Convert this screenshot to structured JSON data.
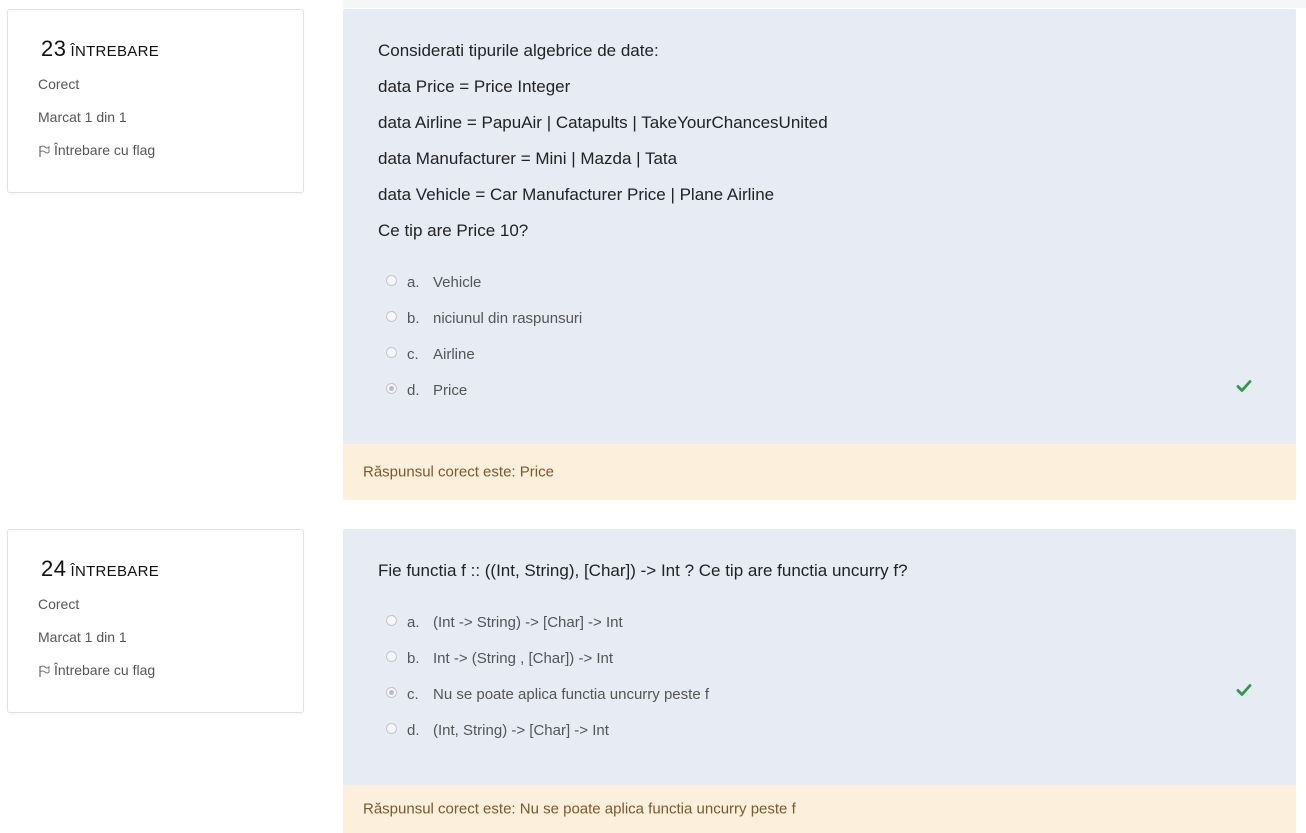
{
  "questions": [
    {
      "number": "23",
      "label": "ÎNTREBARE",
      "state": "Corect",
      "grade": "Marcat 1 din 1",
      "flag_label": "Întrebare cu flag",
      "text_lines": [
        "Considerati tipurile algebrice de date:",
        "data Price = Price Integer",
        "data Airline = PapuAir | Catapults | TakeYourChancesUnited",
        "data Manufacturer = Mini | Mazda | Tata",
        "data Vehicle = Car Manufacturer Price | Plane Airline",
        "Ce tip are Price 10?"
      ],
      "answers": [
        {
          "letter": "a.",
          "text": "Vehicle",
          "selected": false
        },
        {
          "letter": "b.",
          "text": "niciunul din raspunsuri",
          "selected": false
        },
        {
          "letter": "c.",
          "text": "Airline",
          "selected": false
        },
        {
          "letter": "d.",
          "text": "Price",
          "selected": true
        }
      ],
      "feedback": "Răspunsul corect este: Price"
    },
    {
      "number": "24",
      "label": "ÎNTREBARE",
      "state": "Corect",
      "grade": "Marcat 1 din 1",
      "flag_label": "Întrebare cu flag",
      "text_lines": [
        "Fie functia f :: ((Int, String), [Char]) -> Int ? Ce tip are functia uncurry f?"
      ],
      "answers": [
        {
          "letter": "a.",
          "text": "(Int -> String) -> [Char] -> Int",
          "selected": false
        },
        {
          "letter": "b.",
          "text": "Int -> (String , [Char]) -> Int",
          "selected": false
        },
        {
          "letter": "c.",
          "text": "Nu se poate aplica functia uncurry peste f",
          "selected": true
        },
        {
          "letter": "d.",
          "text": "(Int, String) -> [Char] -> Int",
          "selected": false
        }
      ],
      "feedback": "Răspunsul corect este: Nu se poate aplica functia uncurry peste f"
    }
  ],
  "icons": {
    "flag": "flag-icon",
    "correct": "check-icon"
  },
  "colors": {
    "formulation_bg": "#e7ebf4",
    "feedback_bg": "#fcefdc",
    "feedback_text": "#7a5a29",
    "correct_check": "#2e9a47"
  }
}
